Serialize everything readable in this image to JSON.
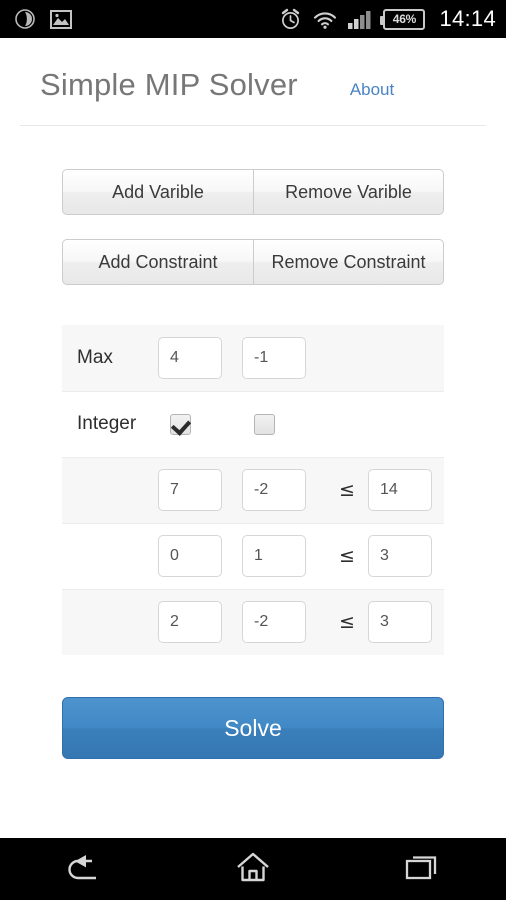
{
  "statusbar": {
    "left_icons": [
      "circle-app-icon",
      "gallery-image-icon"
    ],
    "right_icons": [
      "alarm-clock-icon",
      "wifi-icon",
      "signal-bars-icon"
    ],
    "battery_percent": "46%",
    "time": "14:14"
  },
  "header": {
    "title": "Simple MIP Solver",
    "about_label": "About"
  },
  "toolbar": {
    "add_variable_label": "Add Varible",
    "remove_variable_label": "Remove Varible",
    "add_constraint_label": "Add Constraint",
    "remove_constraint_label": "Remove Constraint"
  },
  "model": {
    "objective": {
      "label": "Max",
      "coefficients": [
        "4",
        "-1"
      ]
    },
    "integer": {
      "label": "Integer",
      "checked": [
        "true",
        "false"
      ]
    },
    "operator_symbol": "≤",
    "constraints": [
      {
        "coefficients": [
          "7",
          "-2"
        ],
        "operator": "≤",
        "rhs": "14"
      },
      {
        "coefficients": [
          "0",
          "1"
        ],
        "operator": "≤",
        "rhs": "3"
      },
      {
        "coefficients": [
          "2",
          "-2"
        ],
        "operator": "≤",
        "rhs": "3"
      }
    ]
  },
  "actions": {
    "solve_label": "Solve"
  },
  "navbar": {
    "back_label": "back-icon",
    "home_label": "home-icon",
    "recents_label": "recent-apps-icon"
  },
  "colors": {
    "accent_blue": "#3a7fbb",
    "link_blue": "#4a84c4",
    "title_gray": "#777777",
    "row_shade": "#f7f7f7"
  }
}
